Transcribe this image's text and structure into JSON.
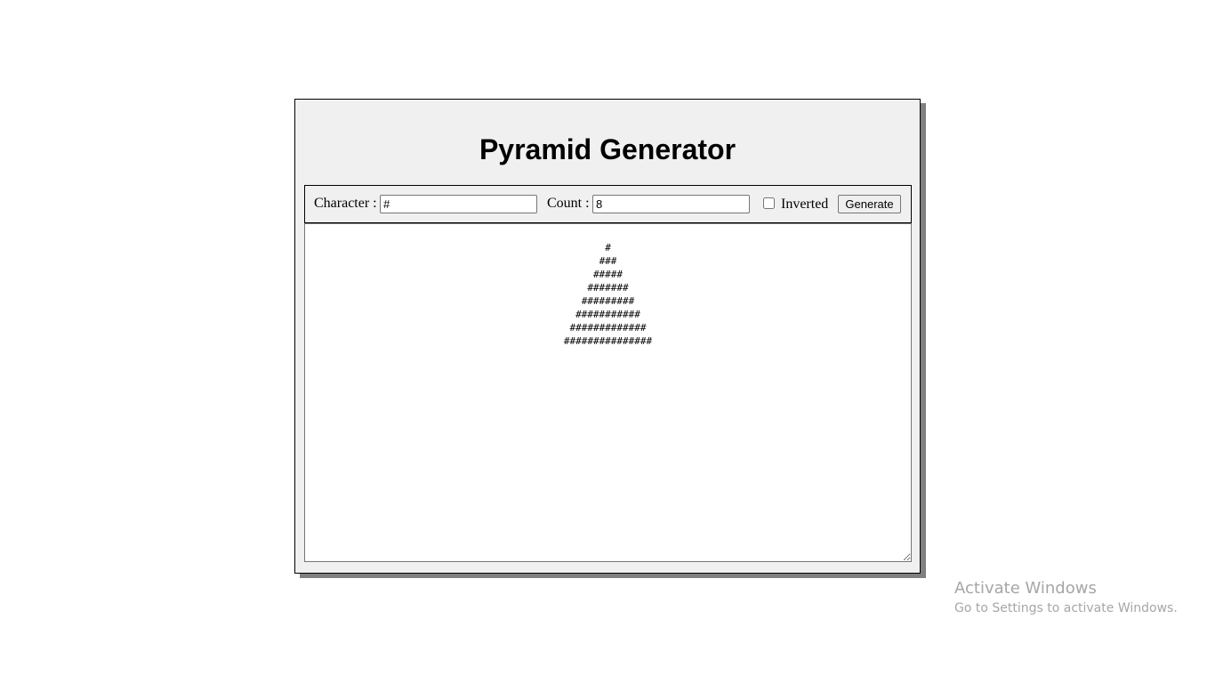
{
  "app": {
    "title": "Pyramid Generator"
  },
  "controls": {
    "character_label": "Character :",
    "character_value": "#",
    "count_label": "Count :",
    "count_value": "8",
    "inverted_label": "Inverted",
    "inverted_checked": false,
    "generate_label": "Generate"
  },
  "output": {
    "text": "#\n###\n#####\n#######\n#########\n###########\n#############\n###############"
  },
  "watermark": {
    "title": "Activate Windows",
    "subtitle": "Go to Settings to activate Windows."
  },
  "colors": {
    "panel_bg": "#f0f0f0",
    "shadow": "#808080",
    "watermark_text": "#a6a6a6"
  }
}
